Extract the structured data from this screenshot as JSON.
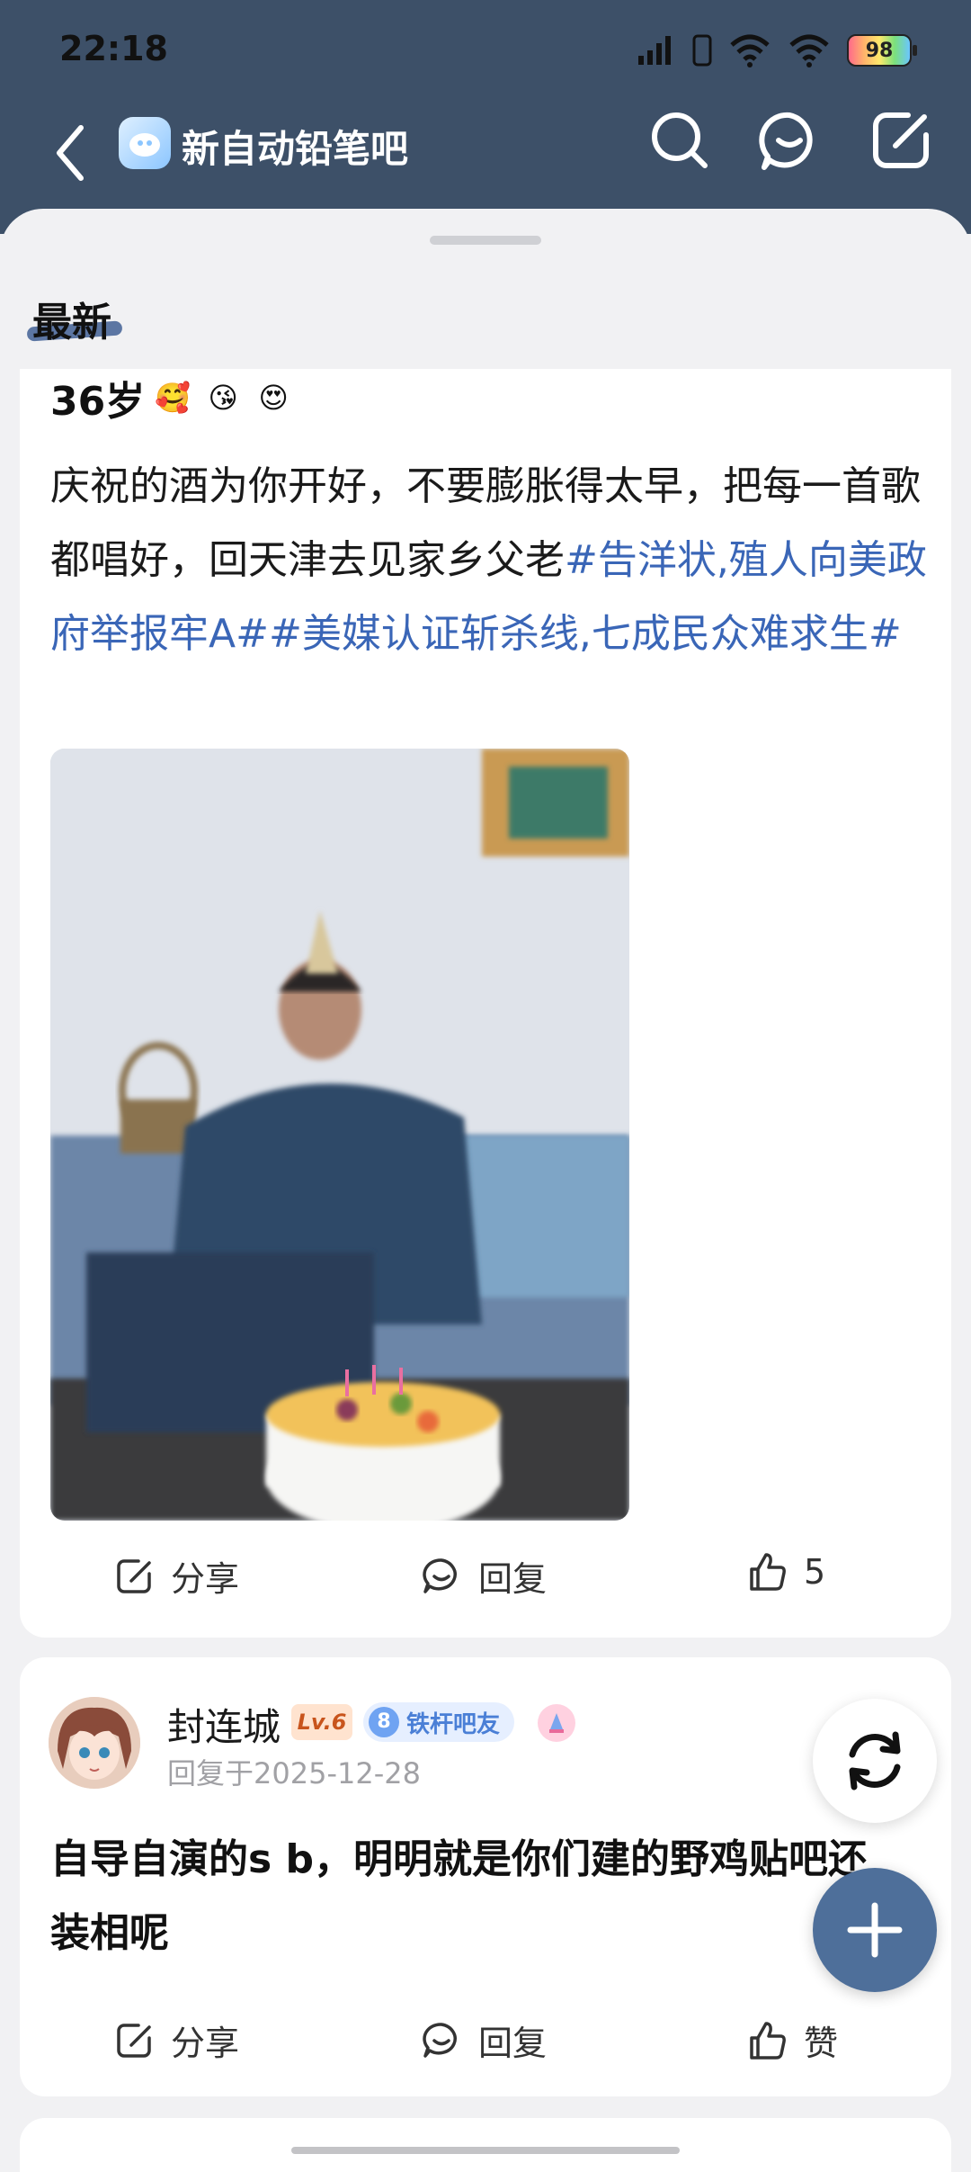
{
  "status_bar": {
    "time": "22:18",
    "battery_level": "98"
  },
  "nav": {
    "forum_name": "新自动铅笔吧"
  },
  "section": {
    "title": "最新"
  },
  "post": {
    "title": "36岁",
    "title_emojis": [
      "🥰",
      "😘",
      "😍"
    ],
    "body_text": "庆祝的酒为你开好，不要膨胀得太早，把每一首歌都唱好，回天津去见家乡父老",
    "hashtags": "#告洋状,殖人向美政府举报牢A##美媒认证斩杀线,七成民众难求生#",
    "actions": {
      "share": "分享",
      "reply": "回复",
      "like_count": "5"
    }
  },
  "comment": {
    "username": "封连城",
    "level": "Lv.6",
    "badge_num": "8",
    "badge_title": "铁杆吧友",
    "reply_time": "回复于2025-12-28",
    "text": "自导自演的s b，明明就是你们建的野鸡贴吧还装相呢",
    "actions": {
      "share": "分享",
      "reply": "回复",
      "like": "赞"
    }
  },
  "colors": {
    "header_bg": "#3d5068",
    "link": "#3a66b7",
    "fab": "#4e6f9a"
  }
}
